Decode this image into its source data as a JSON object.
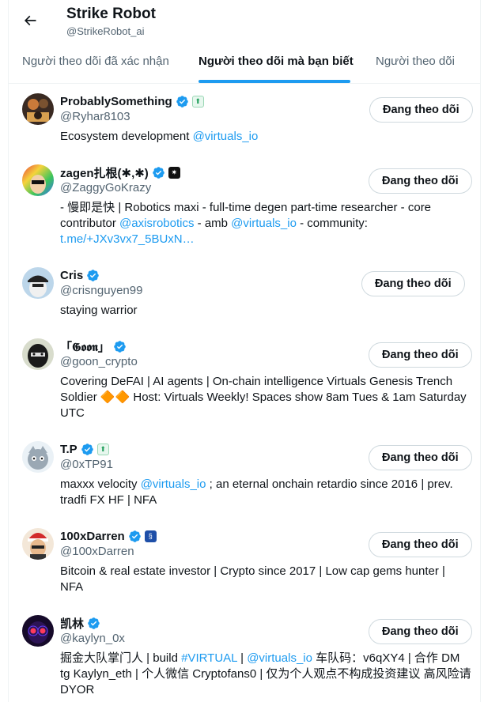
{
  "header": {
    "title": "Strike Robot",
    "handle": "@StrikeRobot_ai"
  },
  "tabs": [
    {
      "label": "Người theo dõi đã xác nhận",
      "active": false
    },
    {
      "label": "Người theo dõi mà bạn biết",
      "active": true
    },
    {
      "label": "Người theo dõi",
      "active": false
    }
  ],
  "colors": {
    "accent": "#1d9bf0",
    "verified": "#1d9bf0",
    "text_primary": "#0f1419",
    "text_secondary": "#536471"
  },
  "follow_label": "Đang theo dõi",
  "users": [
    {
      "name": "ProbablySomething",
      "handle": "@Ryhar8103",
      "verified": true,
      "affiliate_icon": "green-badge-icon",
      "bio": [
        {
          "t": "Ecosystem development "
        },
        {
          "t": "@virtuals_io",
          "link": true
        }
      ]
    },
    {
      "name": "zagen扎根(✱,✱)",
      "handle": "@ZaggyGoKrazy",
      "verified": true,
      "affiliate_icon": "dark-sparkle-badge-icon",
      "bio": [
        {
          "t": "- 慢即是快 | Robotics maxi - full-time degen part-time researcher - core contributor "
        },
        {
          "t": "@axisrobotics",
          "link": true
        },
        {
          "t": " - amb "
        },
        {
          "t": "@virtuals_io",
          "link": true
        },
        {
          "t": " - community: "
        },
        {
          "t": "t.me/+JXv3vx7_5BUxN…",
          "link": true
        }
      ]
    },
    {
      "name": "Cris",
      "handle": "@crisnguyen99",
      "verified": true,
      "affiliate_icon": "",
      "bio": [
        {
          "t": "staying warrior"
        }
      ]
    },
    {
      "name": "「𝕲𝖔𝖔𝖓」",
      "handle": "@goon_crypto",
      "verified": true,
      "affiliate_icon": "",
      "bio": [
        {
          "t": "Covering DeFAI | AI agents | On-chain intelligence Virtuals Genesis Trench Soldier 🔶🔶 Host: Virtuals Weekly! Spaces show 8am Tues & 1am Saturday UTC"
        }
      ]
    },
    {
      "name": "T.P",
      "handle": "@0xTP91",
      "verified": true,
      "affiliate_icon": "green-badge-icon",
      "bio": [
        {
          "t": "maxxx velocity "
        },
        {
          "t": "@virtuals_io",
          "link": true
        },
        {
          "t": " ; an eternal onchain retardio since 2016 | prev. tradfi FX HF | NFA"
        }
      ]
    },
    {
      "name": "100xDarren",
      "handle": "@100xDarren",
      "verified": true,
      "affiliate_icon": "blue-swirl-badge-icon",
      "bio": [
        {
          "t": "Bitcoin & real estate investor | Crypto since 2017 | Low cap gems hunter | NFA"
        }
      ]
    },
    {
      "name": "凯林",
      "handle": "@kaylyn_0x",
      "verified": true,
      "affiliate_icon": "",
      "bio": [
        {
          "t": "掘金大队掌门人 | build "
        },
        {
          "t": "#VIRTUAL",
          "link": true
        },
        {
          "t": " | "
        },
        {
          "t": "@virtuals_io",
          "link": true
        },
        {
          "t": " 车队码：v6qXY4 | 合作 DM tg Kaylyn_eth | 个人微信 Cryptofans0 | 仅为个人观点不构成投资建议 高风险请DYOR"
        }
      ]
    }
  ]
}
